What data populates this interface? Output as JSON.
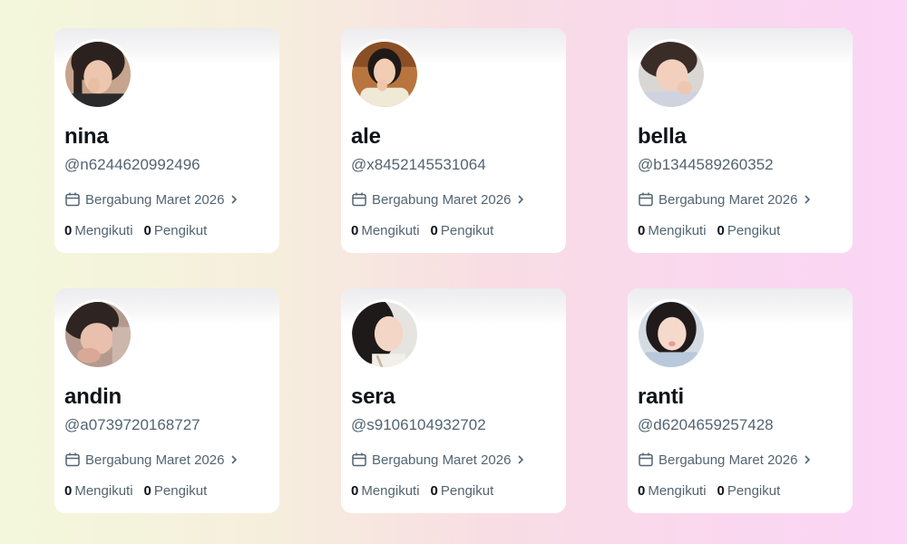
{
  "profiles": [
    {
      "name": "nina",
      "handle": "@n6244620992496",
      "joined": "Bergabung Maret 2026",
      "following_count": "0",
      "following_label": "Mengikuti",
      "followers_count": "0",
      "followers_label": "Pengikut"
    },
    {
      "name": "ale",
      "handle": "@x8452145531064",
      "joined": "Bergabung Maret 2026",
      "following_count": "0",
      "following_label": "Mengikuti",
      "followers_count": "0",
      "followers_label": "Pengikut"
    },
    {
      "name": "bella",
      "handle": "@b1344589260352",
      "joined": "Bergabung Maret 2026",
      "following_count": "0",
      "following_label": "Mengikuti",
      "followers_count": "0",
      "followers_label": "Pengikut"
    },
    {
      "name": "andin",
      "handle": "@a0739720168727",
      "joined": "Bergabung Maret 2026",
      "following_count": "0",
      "following_label": "Mengikuti",
      "followers_count": "0",
      "followers_label": "Pengikut"
    },
    {
      "name": "sera",
      "handle": "@s9106104932702",
      "joined": "Bergabung Maret 2026",
      "following_count": "0",
      "following_label": "Mengikuti",
      "followers_count": "0",
      "followers_label": "Pengikut"
    },
    {
      "name": "ranti",
      "handle": "@d6204659257428",
      "joined": "Bergabung Maret 2026",
      "following_count": "0",
      "following_label": "Mengikuti",
      "followers_count": "0",
      "followers_label": "Pengikut"
    }
  ],
  "icons": {
    "joined": "calendar-icon",
    "expand": "chevron-right-icon"
  },
  "colors": {
    "name": "#0f1419",
    "secondary": "#536471",
    "card": "#ffffff"
  }
}
